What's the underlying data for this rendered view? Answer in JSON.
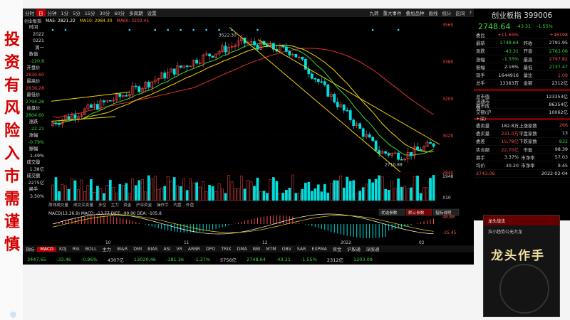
{
  "overlay": {
    "left_caption_chars": [
      "投",
      "资",
      "有",
      "风",
      "险",
      "入",
      "市",
      "需",
      "谨",
      "慎"
    ]
  },
  "toolbar": {
    "items": [
      "分时",
      "日",
      "分钟",
      "1分",
      "5分",
      "15分",
      "30分",
      "60分",
      "多周期",
      "设置"
    ],
    "right_items": [
      "九转",
      "重大事件",
      "叠加品种",
      "画线",
      "统计",
      "区间",
      "?"
    ]
  },
  "ma_line": {
    "name": "创业板指",
    "items": [
      {
        "label": "MA5: 2821.22",
        "color": "#ffffff"
      },
      {
        "label": "MA10: 2984.30",
        "color": "#f5d400"
      },
      {
        "label": "MA60: 3202.45",
        "color": "#ff4d4d"
      }
    ]
  },
  "info_panel": [
    {
      "k": "时间",
      "v": "2022",
      "c": "w"
    },
    {
      "k": "",
      "v": "0221",
      "c": "w"
    },
    {
      "k": "",
      "v": "周一",
      "c": "w"
    },
    {
      "k": "数值",
      "v": "-120.8",
      "c": "g"
    },
    {
      "k": "开盘价",
      "v": "2830.60",
      "c": "r"
    },
    {
      "k": "最高价",
      "v": "2836.28",
      "c": "r"
    },
    {
      "k": "最低价",
      "v": "2794.26",
      "c": "g"
    },
    {
      "k": "收盘价",
      "v": "2804.60",
      "c": "g"
    },
    {
      "k": "涨跌",
      "v": "-22.21",
      "c": "g"
    },
    {
      "k": "涨幅",
      "v": "-0.79%",
      "c": "g"
    },
    {
      "k": "振幅",
      "v": "1.49%",
      "c": "w"
    },
    {
      "k": "成交量",
      "v": "1.38亿",
      "c": "w"
    },
    {
      "k": "成交额",
      "v": "2275亿",
      "c": "w"
    },
    {
      "k": "换手",
      "v": "3.50%",
      "c": "w"
    }
  ],
  "price_axis": [
    "3560",
    "3380",
    "3200",
    "3020",
    "2840"
  ],
  "annotations": {
    "high": "3522.30",
    "low": "2710.88"
  },
  "volume_axis": [
    "1948",
    "X10"
  ],
  "macd": {
    "label": "MACD(12,26,9)",
    "values": "MACD: -13.77  DIFF: -99.90  DEA: -105.8",
    "axis": [
      "48.88",
      "-35.45"
    ],
    "buttons": [
      "优选参数",
      "默认参数",
      "指标说明"
    ]
  },
  "time_axis": [
    "10",
    "11",
    "12",
    "2022",
    "02"
  ],
  "ind_tabs": [
    "指标",
    "MACD",
    "KDJ",
    "RSI",
    "BOLL",
    "主力",
    "W&R",
    "DMI",
    "BIAS",
    "ASI",
    "VR",
    "ARBR",
    "DPO",
    "TRIX",
    "DMA",
    "BBI",
    "MTM",
    "OBV",
    "SAR",
    "EXPMA",
    "资金",
    "沪股通",
    "深股通"
  ],
  "sub_tabs": [
    "周线成交量",
    "成交买卖量",
    "多空",
    "主力",
    "资金",
    "沪深资金",
    "操作手",
    "内盘",
    "外盘"
  ],
  "index_row": [
    {
      "v": "3447.65",
      "c": "grn"
    },
    {
      "v": "-33.46",
      "c": "grn"
    },
    {
      "v": "-0.96%",
      "c": "grn"
    },
    {
      "v": "4307亿",
      "c": "wht"
    },
    {
      "v": "13020.46",
      "c": "grn"
    },
    {
      "v": "-181.36",
      "c": "grn"
    },
    {
      "v": "-1.37%",
      "c": "grn"
    },
    {
      "v": "5756亿",
      "c": "wht"
    },
    {
      "v": "2748.64",
      "c": "grn"
    },
    {
      "v": "-43.31",
      "c": "grn"
    },
    {
      "v": "-1.55%",
      "c": "grn"
    },
    {
      "v": "2312亿",
      "c": "wht"
    },
    {
      "v": "1203.09",
      "c": "grn"
    }
  ],
  "quote": {
    "title": "创业板指  399006",
    "price": "2748.64",
    "change": "-43.31",
    "pct": "-1.55%",
    "rows1": [
      {
        "c1": "委比",
        "c2": "+11.65%",
        "c2c": "red",
        "c3": "",
        "c4": "+48198",
        "c4c": "red"
      },
      {
        "c1": "最新",
        "c2": "2748.64",
        "c2c": "grn",
        "c3": "昨收",
        "c4": "2791.95",
        "c4c": "wht"
      },
      {
        "c1": "涨跌",
        "c2": "-43.31",
        "c2c": "grn",
        "c3": "开盘",
        "c4": "2763.06",
        "c4c": "grn"
      },
      {
        "c1": "涨幅",
        "c2": "-1.55%",
        "c2c": "grn",
        "c3": "最高",
        "c4": "2797.82",
        "c4c": "red"
      },
      {
        "c1": "振幅",
        "c2": "2.16%",
        "c2c": "wht",
        "c3": "最低",
        "c4": "2737.47",
        "c4c": "grn"
      },
      {
        "c1": "现手",
        "c2": "1644916",
        "c2c": "wht",
        "c3": "量比",
        "c4": "1.09",
        "c4c": "red"
      },
      {
        "c1": "总手",
        "c2": "13363万",
        "c2c": "wht",
        "c3": "金额",
        "c4": "2312亿",
        "c4c": "wht"
      }
    ],
    "rows2": [
      {
        "c1": "总市值",
        "c2": "",
        "c2c": "wht",
        "c3": "",
        "c4": "123353亿",
        "c4c": "wht"
      },
      {
        "c1": "流通市值",
        "c2": "",
        "c2c": "wht",
        "c3": "",
        "c4": "86354亿",
        "c4c": "wht"
      },
      {
        "c1": "两市成交额(沪+深)",
        "c2": "",
        "c2c": "wht",
        "c3": "",
        "c4": "10062亿",
        "c4c": "wht"
      }
    ],
    "rows3": [
      {
        "c1": "委卖量",
        "c2": "182.8万",
        "c2c": "wht",
        "c3": "上涨家数",
        "c4": "266",
        "c4c": "red"
      },
      {
        "c1": "委买量",
        "c2": "231.0万",
        "c2c": "red",
        "c3": "平盘家数",
        "c4": "13",
        "c4c": "wht"
      },
      {
        "c1": "委差",
        "c2": "15.78亿",
        "c2c": "red",
        "c3": "下跌家数",
        "c4": "832",
        "c4c": "grn"
      },
      {
        "c1": "实合额",
        "c2": "22.70亿",
        "c2c": "red",
        "c3": "市盈",
        "c4": "98.39",
        "c4c": "wht"
      },
      {
        "c1": "换手",
        "c2": "3.37%",
        "c2c": "wht",
        "c3": "市净率",
        "c4": "57.03",
        "c4c": "wht"
      },
      {
        "c1": "均价",
        "c2": "30.20",
        "c2c": "wht",
        "c3": "市净率",
        "c4": "9.45",
        "c4c": "wht"
      }
    ],
    "bottom_row": "2743.06",
    "bottom_date": "2022-02-04"
  },
  "book": {
    "tag": "龙头战法",
    "subtitle": "拉小趋势公无大龙",
    "title": "龙头作手",
    "side": "龙头作手"
  },
  "colors": {
    "up": "#ff4d4d",
    "down": "#00e0e0",
    "ma5": "#ffffff",
    "ma10": "#f5d400",
    "ma20": "#3ad93a",
    "ma60": "#e03030"
  }
}
